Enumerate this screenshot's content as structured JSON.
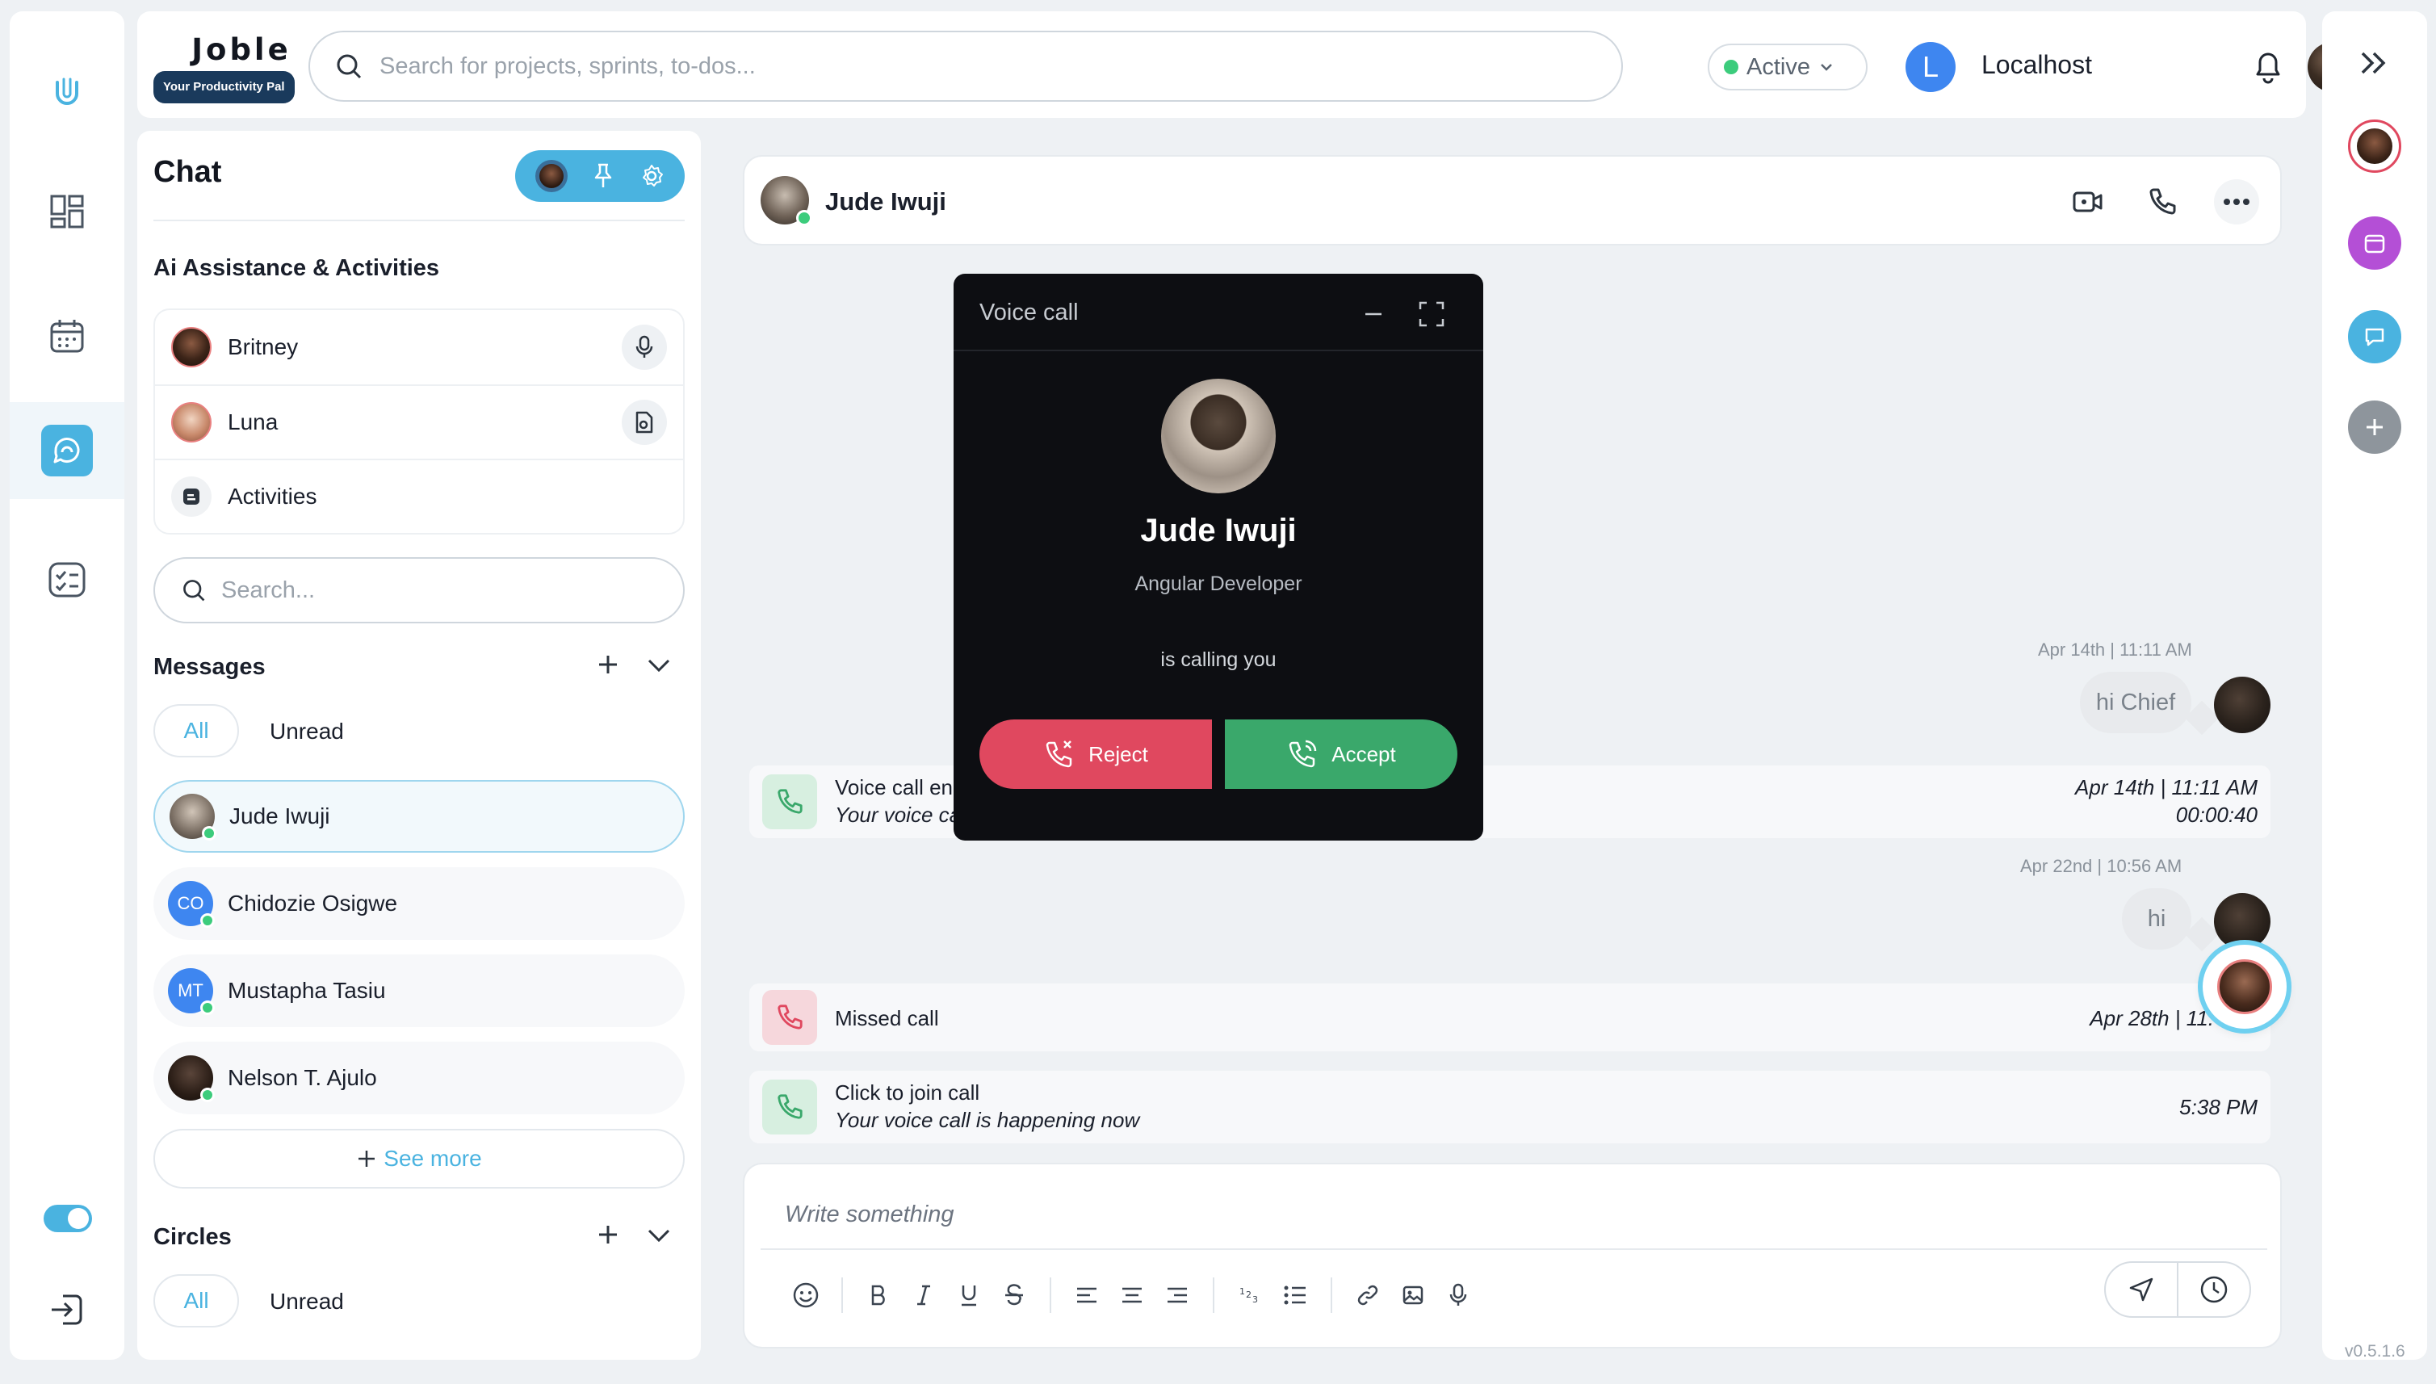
{
  "header": {
    "logo": "Joble",
    "tagline": "Your Productivity Pal",
    "search_placeholder": "Search for projects, sprints, to-dos...",
    "status": "Active",
    "user_initial": "L",
    "user_name": "Localhost"
  },
  "chat_panel": {
    "title": "Chat",
    "ai_section_title": "Ai Assistance & Activities",
    "ai_items": [
      {
        "name": "Britney",
        "icon": "microphone-icon"
      },
      {
        "name": "Luna",
        "icon": "document-icon"
      },
      {
        "name": "Activities",
        "icon": "activities-icon"
      }
    ],
    "search_placeholder": "Search...",
    "messages_title": "Messages",
    "filter_all": "All",
    "filter_unread": "Unread",
    "messages": [
      {
        "name": "Jude Iwuji",
        "initials": "",
        "color": "#8f8579",
        "selected": true
      },
      {
        "name": "Chidozie Osigwe",
        "initials": "CO",
        "color": "#3e86f0",
        "selected": false
      },
      {
        "name": "Mustapha Tasiu",
        "initials": "MT",
        "color": "#3e86f0",
        "selected": false
      },
      {
        "name": "Nelson T. Ajulo",
        "initials": "",
        "color": "#2e2420",
        "selected": false
      }
    ],
    "see_more": "See more",
    "circles_title": "Circles",
    "circles_filter_all": "All",
    "circles_filter_unread": "Unread"
  },
  "conversation": {
    "name": "Jude Iwuji",
    "messages": [
      {
        "timestamp": "Apr 14th | 11:11 AM",
        "text": "hi Chief"
      },
      {
        "timestamp": "Apr 22nd | 10:56 AM",
        "text": "hi"
      }
    ],
    "call_logs": [
      {
        "title": "Voice call en",
        "subtitle": "Your voice ca",
        "right_line1": "Apr 14th | 11:11 AM",
        "right_line2": "00:00:40",
        "type": "ended"
      },
      {
        "title": "Missed call",
        "subtitle": "",
        "right_line1": "Apr 28th | 11:",
        "right_line2": "",
        "type": "missed"
      },
      {
        "title": "Click to join call",
        "subtitle": "Your voice call is happening now",
        "right_line1": "5:38 PM",
        "right_line2": "",
        "type": "join"
      }
    ],
    "composer_placeholder": "Write something"
  },
  "voice_call": {
    "title": "Voice call",
    "caller_name": "Jude Iwuji",
    "caller_role": "Angular Developer",
    "calling_text": "is calling you",
    "reject_label": "Reject",
    "accept_label": "Accept"
  },
  "version": "v0.5.1.6",
  "colors": {
    "accent": "#4ab3e0",
    "online": "#3ccc7c",
    "reject": "#e0485f",
    "accept": "#3aa86b",
    "logo_badge": "#1a3a5c"
  }
}
